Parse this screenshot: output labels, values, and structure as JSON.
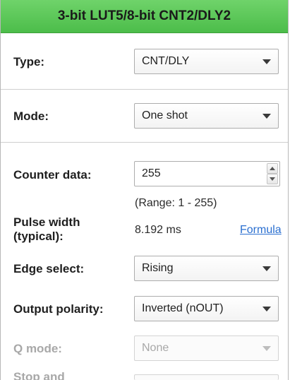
{
  "panel": {
    "title": "3-bit LUT5/8-bit CNT2/DLY2"
  },
  "type": {
    "label": "Type:",
    "value": "CNT/DLY"
  },
  "mode": {
    "label": "Mode:",
    "value": "One shot"
  },
  "counter": {
    "label": "Counter data:",
    "value": "255",
    "range": "(Range:  1 - 255)"
  },
  "pulse": {
    "label_line1": "Pulse width",
    "label_line2": "(typical):",
    "value": "8.192 ms",
    "formula_link": "Formula"
  },
  "edge": {
    "label": "Edge select:",
    "value": "Rising"
  },
  "polarity": {
    "label": "Output polarity:",
    "value": "Inverted (nOUT)"
  },
  "qmode": {
    "label": "Q mode:",
    "value": "None"
  },
  "stop": {
    "label": "Stop and"
  }
}
